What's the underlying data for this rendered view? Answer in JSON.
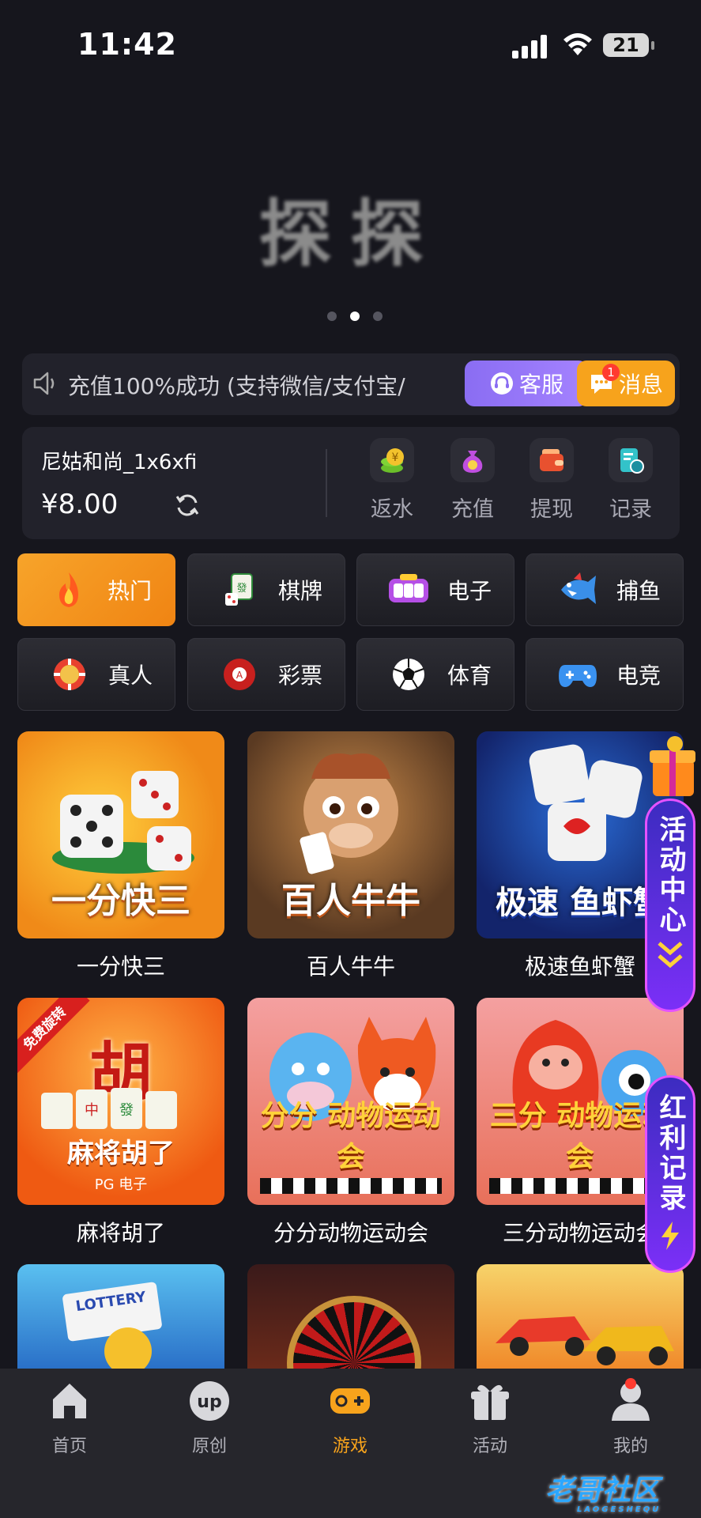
{
  "status": {
    "time": "11:42",
    "battery": "21"
  },
  "banner": {
    "text": "探探"
  },
  "notice": {
    "text": "充值100%成功 (支持微信/支付宝/",
    "cs_label": "客服",
    "msg_label": "消息",
    "msg_count": "1"
  },
  "account": {
    "username": "尼姑和尚_1x6xfi",
    "balance": "¥8.00",
    "actions": [
      {
        "label": "返水",
        "icon": "coin-stack-icon"
      },
      {
        "label": "充值",
        "icon": "money-bag-icon"
      },
      {
        "label": "提现",
        "icon": "wallet-icon"
      },
      {
        "label": "记录",
        "icon": "record-icon"
      }
    ]
  },
  "categories": [
    {
      "label": "热门",
      "icon": "fire-icon"
    },
    {
      "label": "棋牌",
      "icon": "mahjong-icon"
    },
    {
      "label": "电子",
      "icon": "slot-machine-icon"
    },
    {
      "label": "捕鱼",
      "icon": "fish-icon"
    },
    {
      "label": "真人",
      "icon": "chip-icon"
    },
    {
      "label": "彩票",
      "icon": "lottery-ball-icon"
    },
    {
      "label": "体育",
      "icon": "soccer-ball-icon"
    },
    {
      "label": "电竞",
      "icon": "gamepad-icon"
    }
  ],
  "games": [
    {
      "name": "一分快三",
      "thumb_title": "一分快三"
    },
    {
      "name": "百人牛牛",
      "thumb_title": "百人牛牛"
    },
    {
      "name": "极速鱼虾蟹",
      "thumb_title": "极速 鱼虾蟹"
    },
    {
      "name": "麻将胡了",
      "thumb_title": "麻将胡了",
      "thumb_sub": "PG 电子",
      "ribbon": "免费旋转",
      "big_char": "胡"
    },
    {
      "name": "分分动物运动会",
      "thumb_title": "分分 动物运动会"
    },
    {
      "name": "三分动物运动会",
      "thumb_title": "三分 动物运动会"
    },
    {
      "name": "",
      "thumb_title": "LOTTERY"
    },
    {
      "name": "",
      "thumb_title": ""
    },
    {
      "name": "",
      "thumb_title": ""
    }
  ],
  "floating": {
    "activity": "活动中心",
    "bonus": "红利记录"
  },
  "tabs": [
    {
      "label": "首页",
      "icon": "home-icon"
    },
    {
      "label": "原创",
      "icon": "up-icon"
    },
    {
      "label": "游戏",
      "icon": "game-controller-icon"
    },
    {
      "label": "活动",
      "icon": "gift-icon"
    },
    {
      "label": "我的",
      "icon": "profile-icon"
    }
  ],
  "watermark": {
    "text": "老哥社区",
    "sub": "LAOGESHEQU"
  },
  "colors": {
    "background": "#16161d",
    "accent": "#f7a31c",
    "purple": "#8a6df2"
  }
}
